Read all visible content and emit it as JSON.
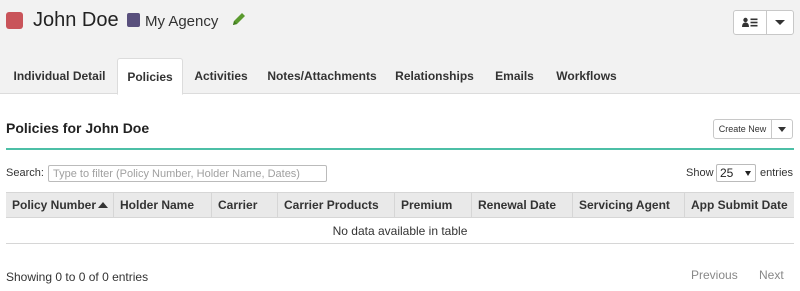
{
  "header": {
    "name": "John Doe",
    "name_color": "#c9545a",
    "agency": "My Agency",
    "agency_color": "#59507d",
    "edit_icon": "pencil-icon",
    "user_menu_icon": "user-list-icon",
    "dropdown_icon": "caret-down-icon"
  },
  "tabs": [
    {
      "label": "Individual Detail",
      "active": false
    },
    {
      "label": "Policies",
      "active": true
    },
    {
      "label": "Activities",
      "active": false
    },
    {
      "label": "Notes/Attachments",
      "active": false
    },
    {
      "label": "Relationships",
      "active": false
    },
    {
      "label": "Emails",
      "active": false
    },
    {
      "label": "Workflows",
      "active": false
    }
  ],
  "section": {
    "title": "Policies for John Doe",
    "create_label": "Create New",
    "rule_color": "#4cbfa6"
  },
  "filter": {
    "search_label": "Search:",
    "search_placeholder": "Type to filter (Policy Number, Holder Name, Dates)",
    "show_label": "Show",
    "page_size": "25",
    "entries_label": "entries"
  },
  "table": {
    "columns": [
      "Policy Number",
      "Holder Name",
      "Carrier",
      "Carrier Products",
      "Premium",
      "Renewal Date",
      "Servicing Agent",
      "App Submit Date"
    ],
    "sorted_column": "Policy Number",
    "empty_message": "No data available in table"
  },
  "pagination": {
    "info": "Showing 0 to 0 of 0 entries",
    "previous": "Previous",
    "next": "Next"
  }
}
